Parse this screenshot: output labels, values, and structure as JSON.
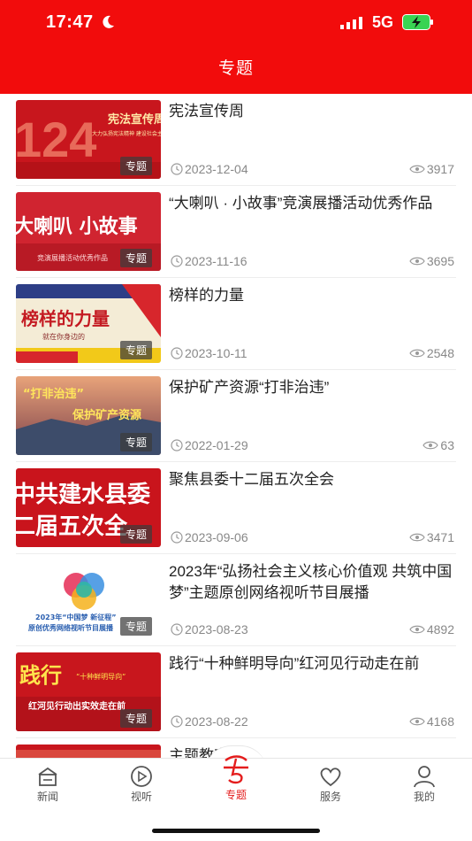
{
  "status": {
    "time": "17:47",
    "network": "5G"
  },
  "header": {
    "title": "专题"
  },
  "colors": {
    "brand": "#f20c0c",
    "active_tab": "#e41d1d"
  },
  "items": [
    {
      "title": "宪法宣传周",
      "date": "2023-12-04",
      "views": "3917",
      "tag": "专题",
      "thumb_text": "宪法宣传周",
      "thumb_sub": "大力弘扬宪法精神 建设社会主义法治文化"
    },
    {
      "title": "“大喇叭 · 小故事”竞演展播活动优秀作品",
      "date": "2023-11-16",
      "views": "3695",
      "tag": "专题",
      "thumb_text": "大喇叭 小故事",
      "thumb_sub": "竞演展播活动优秀作品"
    },
    {
      "title": "榜样的力量",
      "date": "2023-10-11",
      "views": "2548",
      "tag": "专题",
      "thumb_text": "榜样的力量",
      "thumb_sub": "就在你身边的"
    },
    {
      "title": "保护矿产资源“打非治违”",
      "date": "2022-01-29",
      "views": "63",
      "tag": "专题",
      "thumb_text": "“打非治违”",
      "thumb_sub": "保护矿产资源"
    },
    {
      "title": "聚焦县委十二届五次全会",
      "date": "2023-09-06",
      "views": "3471",
      "tag": "专题",
      "thumb_text": "中共建水县委",
      "thumb_sub": "二届五次全"
    },
    {
      "title": "2023年“弘扬社会主义核心价值观 共筑中国梦”主题原创网络视听节目展播",
      "date": "2023-08-23",
      "views": "4892",
      "tag": "专题",
      "thumb_text": "2023年“中国梦 新征程”",
      "thumb_sub": "原创优秀网络视听节目展播"
    },
    {
      "title": "践行“十种鲜明导向”红河见行动走在前",
      "date": "2023-08-22",
      "views": "4168",
      "tag": "专题",
      "thumb_text": "践行",
      "thumb_sub": "红河见行动出实效走在前"
    },
    {
      "title": "主题教育",
      "date": "",
      "views": "",
      "tag": "",
      "thumb_text": "",
      "thumb_sub": ""
    }
  ],
  "tabs": [
    {
      "label": "新闻",
      "icon": "news-icon"
    },
    {
      "label": "视听",
      "icon": "play-icon"
    },
    {
      "label": "专题",
      "icon": "topic-icon"
    },
    {
      "label": "服务",
      "icon": "heart-icon"
    },
    {
      "label": "我的",
      "icon": "user-icon"
    }
  ]
}
